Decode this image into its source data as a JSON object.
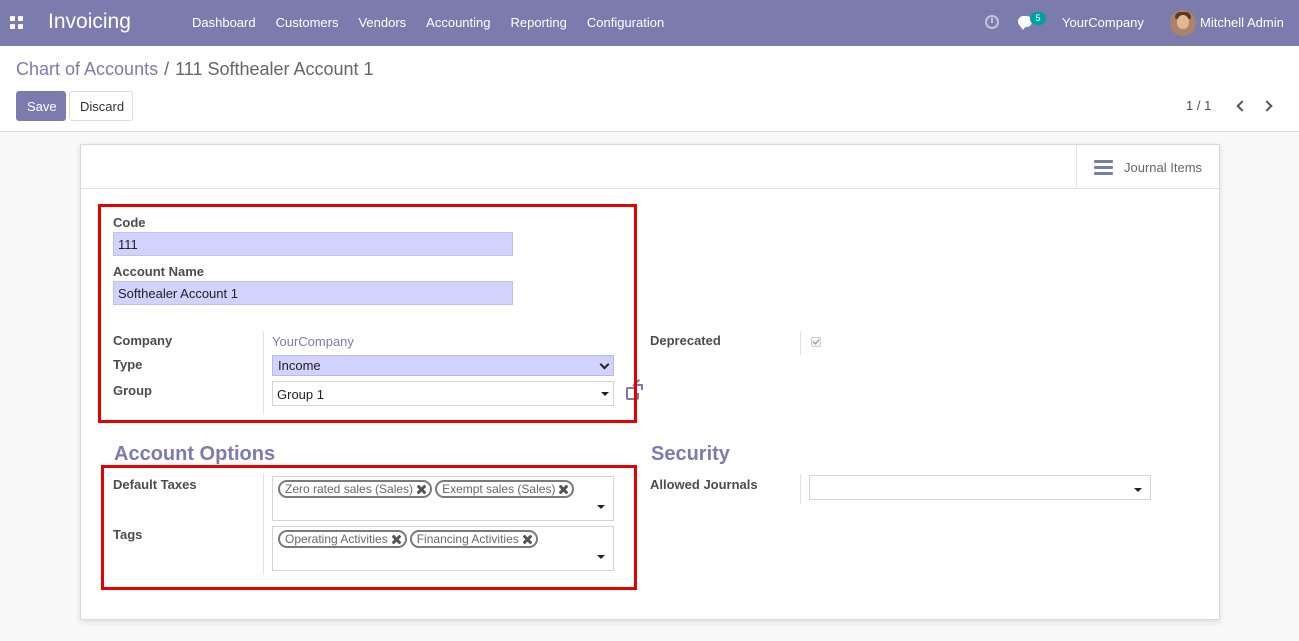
{
  "navbar": {
    "brand": "Invoicing",
    "menu": [
      "Dashboard",
      "Customers",
      "Vendors",
      "Accounting",
      "Reporting",
      "Configuration"
    ],
    "chat_count": "5",
    "company": "YourCompany",
    "user": "Mitchell Admin",
    "icons": {
      "apps": "apps-grid-icon",
      "clock": "clock-icon",
      "chat": "chat-icon"
    }
  },
  "control_panel": {
    "breadcrumb": {
      "parent": "Chart of Accounts",
      "separator": "/",
      "current": "111 Softhealer Account 1"
    },
    "save_label": "Save",
    "discard_label": "Discard",
    "pager": "1 / 1"
  },
  "form": {
    "journal_items_label": "Journal Items",
    "code": {
      "label": "Code",
      "value": "111"
    },
    "account_name": {
      "label": "Account Name",
      "value": "Softhealer Account 1"
    },
    "company": {
      "label": "Company",
      "value": "YourCompany"
    },
    "type": {
      "label": "Type",
      "value": "Income"
    },
    "group": {
      "label": "Group",
      "value": "Group 1"
    },
    "deprecated": {
      "label": "Deprecated",
      "checked": true
    },
    "account_options": {
      "title": "Account Options",
      "default_taxes": {
        "label": "Default Taxes",
        "tags": [
          "Zero rated sales (Sales)",
          "Exempt sales (Sales)"
        ]
      },
      "tags": {
        "label": "Tags",
        "tags": [
          "Operating Activities",
          "Financing Activities"
        ]
      }
    },
    "security": {
      "title": "Security",
      "allowed_journals": {
        "label": "Allowed Journals",
        "value": ""
      }
    }
  },
  "colors": {
    "primary": "#7c7bad",
    "highlight_box": "#e60000",
    "required_field": "#d2d2ff",
    "badge": "#00a09d"
  }
}
